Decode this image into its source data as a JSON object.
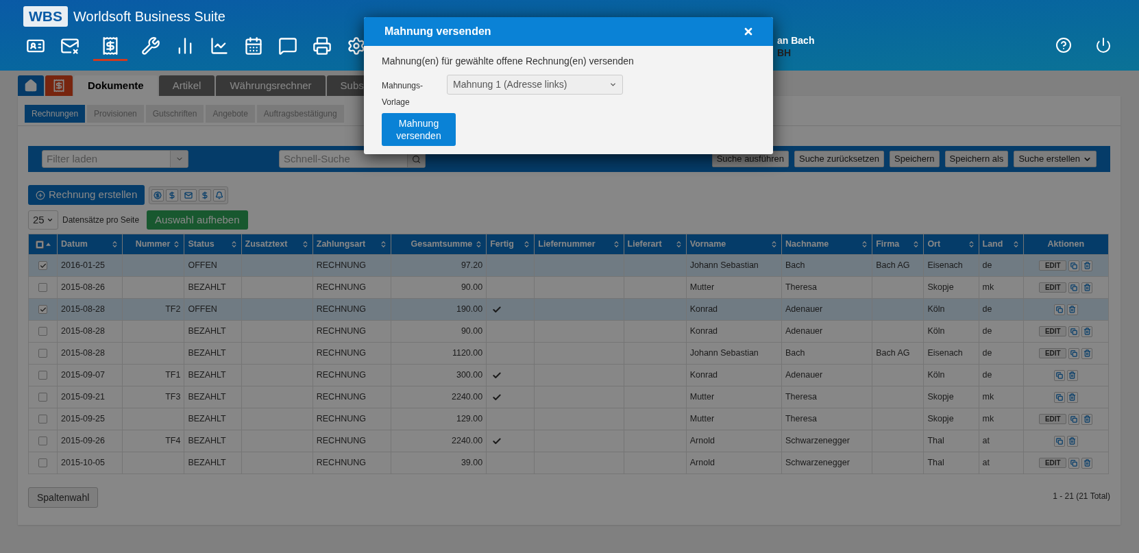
{
  "header": {
    "logo": "WBS",
    "title": "Worldsoft Business Suite",
    "nav": [
      {
        "selected": false
      },
      {
        "selected": false
      },
      {
        "selected": true
      },
      {
        "selected": false
      },
      {
        "selected": false
      },
      {
        "selected": false
      },
      {
        "selected": false
      },
      {
        "selected": false
      },
      {
        "selected": false
      },
      {
        "selected": false
      }
    ],
    "user": {
      "name": "an Bach",
      "company": "BH"
    }
  },
  "tabs": [
    {
      "kind": "home",
      "selected": false
    },
    {
      "kind": "module",
      "selected": false
    },
    {
      "kind": "text",
      "label": "Dokumente",
      "selected": true
    },
    {
      "kind": "text",
      "label": "Artikel",
      "selected": false
    },
    {
      "kind": "text",
      "label": "Währungsrechner",
      "selected": false
    },
    {
      "kind": "text",
      "label": "Subs",
      "selected": false
    }
  ],
  "subtabs": [
    {
      "label": "Rechnungen",
      "selected": true
    },
    {
      "label": "Provisionen",
      "selected": false
    },
    {
      "label": "Gutschriften",
      "selected": false
    },
    {
      "label": "Angebote",
      "selected": false
    },
    {
      "label": "Auftragsbestätigung",
      "selected": false
    }
  ],
  "filter_bar": {
    "filter_placeholder": "Filter laden",
    "search_placeholder": "Schnell-Suche",
    "buttons": [
      "Suche ausführen",
      "Suche zurücksetzen",
      "Speichern",
      "Speichern als",
      "Suche erstellen"
    ]
  },
  "toolbar": {
    "create_button": "Rechnung erstellen",
    "page_size": "25",
    "page_size_label": "Datensätze pro Seite",
    "clear_button": "Auswahl aufheben"
  },
  "table": {
    "select_all": {
      "partial": true
    },
    "columns": [
      {
        "label": "Datum"
      },
      {
        "label": "Nummer"
      },
      {
        "label": "Status"
      },
      {
        "label": "Zusatztext"
      },
      {
        "label": "Zahlungsart"
      },
      {
        "label": "Gesamtsumme"
      },
      {
        "label": "Fertig"
      },
      {
        "label": "Liefernummer"
      },
      {
        "label": "Lieferart"
      },
      {
        "label": "Vorname"
      },
      {
        "label": "Nachname"
      },
      {
        "label": "Firma"
      },
      {
        "label": "Ort"
      },
      {
        "label": "Land"
      },
      {
        "label": "Aktionen"
      }
    ],
    "rows": [
      {
        "selected": true,
        "checked": true,
        "done": false,
        "edit": true,
        "cells": {
          "datum": "2016-01-25",
          "status": "OFFEN",
          "zahlungsart": "RECHNUNG",
          "summe": "97.20",
          "vorname": "Johann Sebastian",
          "nachname": "Bach",
          "firma": "Bach AG",
          "ort": "Eisenach",
          "land": "de"
        },
        "edit_label": "EDIT"
      },
      {
        "selected": false,
        "checked": false,
        "done": false,
        "edit": true,
        "cells": {
          "datum": "2015-08-26",
          "status": "BEZAHLT",
          "zahlungsart": "RECHNUNG",
          "summe": "90.00",
          "vorname": "Mutter",
          "nachname": "Theresa",
          "ort": "Skopje",
          "land": "mk"
        },
        "edit_label": "EDIT"
      },
      {
        "selected": true,
        "checked": true,
        "done": true,
        "edit": false,
        "cells": {
          "datum": "2015-08-28",
          "nummer": "TF2",
          "status": "OFFEN",
          "zahlungsart": "RECHNUNG",
          "summe": "190.00",
          "vorname": "Konrad",
          "nachname": "Adenauer",
          "ort": "Köln",
          "land": "de"
        }
      },
      {
        "selected": false,
        "checked": false,
        "done": false,
        "edit": true,
        "cells": {
          "datum": "2015-08-28",
          "status": "BEZAHLT",
          "zahlungsart": "RECHNUNG",
          "summe": "90.00",
          "vorname": "Konrad",
          "nachname": "Adenauer",
          "ort": "Köln",
          "land": "de"
        },
        "edit_label": "EDIT"
      },
      {
        "selected": false,
        "checked": false,
        "done": false,
        "edit": true,
        "cells": {
          "datum": "2015-08-28",
          "status": "BEZAHLT",
          "zahlungsart": "RECHNUNG",
          "summe": "1120.00",
          "vorname": "Johann Sebastian",
          "nachname": "Bach",
          "firma": "Bach AG",
          "ort": "Eisenach",
          "land": "de"
        },
        "edit_label": "EDIT"
      },
      {
        "selected": false,
        "checked": false,
        "done": true,
        "edit": false,
        "cells": {
          "datum": "2015-09-07",
          "nummer": "TF1",
          "status": "BEZAHLT",
          "zahlungsart": "RECHNUNG",
          "summe": "300.00",
          "vorname": "Konrad",
          "nachname": "Adenauer",
          "ort": "Köln",
          "land": "de"
        }
      },
      {
        "selected": false,
        "checked": false,
        "done": true,
        "edit": false,
        "cells": {
          "datum": "2015-09-21",
          "nummer": "TF3",
          "status": "BEZAHLT",
          "zahlungsart": "RECHNUNG",
          "summe": "2240.00",
          "vorname": "Mutter",
          "nachname": "Theresa",
          "ort": "Skopje",
          "land": "mk"
        }
      },
      {
        "selected": false,
        "checked": false,
        "done": false,
        "edit": true,
        "cells": {
          "datum": "2015-09-25",
          "status": "BEZAHLT",
          "zahlungsart": "RECHNUNG",
          "summe": "129.00",
          "vorname": "Mutter",
          "nachname": "Theresa",
          "ort": "Skopje",
          "land": "mk"
        },
        "edit_label": "EDIT"
      },
      {
        "selected": false,
        "checked": false,
        "done": true,
        "edit": false,
        "cells": {
          "datum": "2015-09-26",
          "nummer": "TF4",
          "status": "BEZAHLT",
          "zahlungsart": "RECHNUNG",
          "summe": "2240.00",
          "vorname": "Arnold",
          "nachname": "Schwarzenegger",
          "ort": "Thal",
          "land": "at"
        }
      },
      {
        "selected": false,
        "checked": false,
        "done": false,
        "edit": true,
        "cells": {
          "datum": "2015-10-05",
          "status": "BEZAHLT",
          "zahlungsart": "RECHNUNG",
          "summe": "39.00",
          "vorname": "Arnold",
          "nachname": "Schwarzenegger",
          "ort": "Thal",
          "land": "at"
        },
        "edit_label": "EDIT"
      }
    ]
  },
  "footer": {
    "columns_button": "Spaltenwahl",
    "count": "1 - 21 (21 Total)"
  },
  "modal": {
    "title": "Mahnung versenden",
    "message": "Mahnung(en) für gewählte offene Rechnung(en) versenden",
    "field_label": "Mahnungs-Vorlage",
    "template": "Mahnung 1 (Adresse links)",
    "submit": "Mahnung versenden"
  }
}
